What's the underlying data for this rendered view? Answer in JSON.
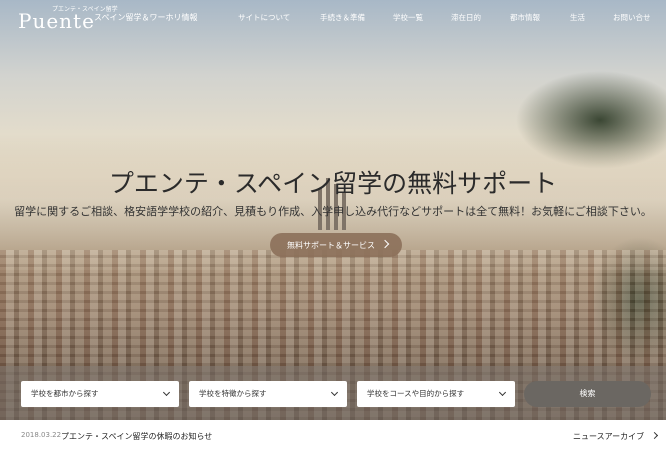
{
  "header": {
    "logo_word": "Puente",
    "logo_tagline": "プエンテ・スペイン留学",
    "site_subtitle": "スペイン留学＆ワーホリ情報",
    "nav": [
      "サイトについて",
      "手続き＆準備",
      "学校一覧",
      "滞在日的",
      "都市情報",
      "生活",
      "お問い合せ"
    ]
  },
  "hero": {
    "title": "プエンテ・スペイン留学の無料サポート",
    "subtitle": "留学に関するご相談、格安語学学校の紹介、見積もり作成、入学申し込み代行などサポートは全て無料！お気軽にご相談下さい。",
    "cta_label": "無料サポート＆サービス"
  },
  "search": {
    "by_city": "学校を都市から探す",
    "by_feature": "学校を特徴から探す",
    "by_course": "学校をコースや目的から探す",
    "button": "検索"
  },
  "news": {
    "date": "2018.03.22",
    "title": "プエンテ・スペイン留学の休暇のお知らせ",
    "archive_label": "ニュースアーカイブ"
  }
}
